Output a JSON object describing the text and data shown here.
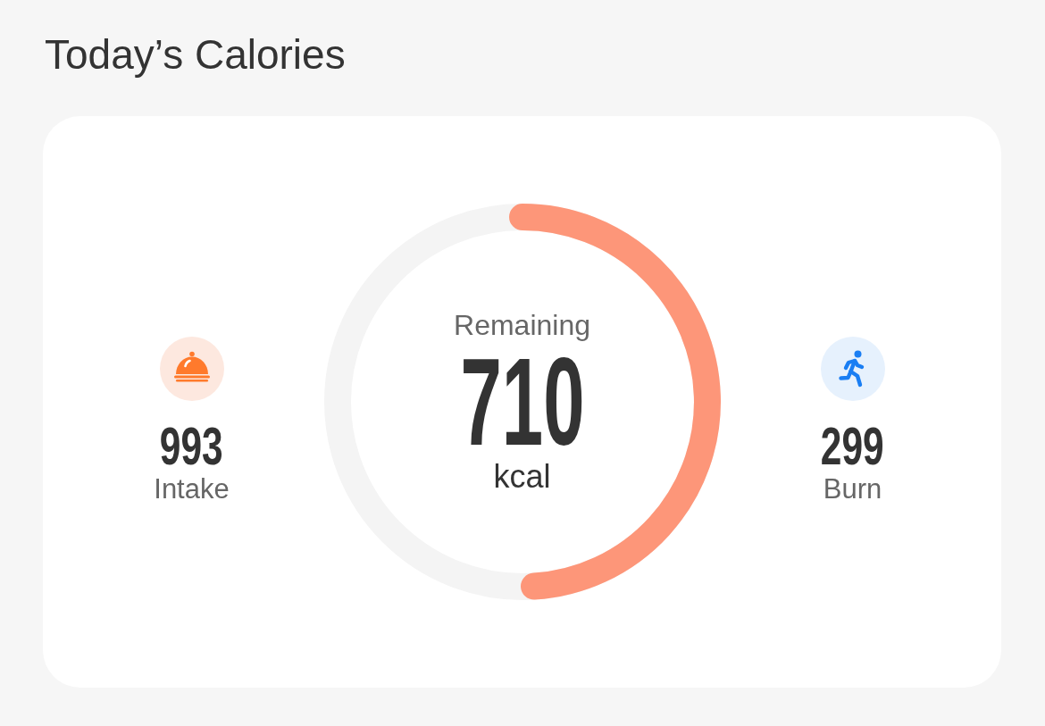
{
  "title": "Today’s Calories",
  "card": {
    "stats": [
      {
        "kind": "intake",
        "value": "993",
        "label": "Intake"
      },
      {
        "kind": "burn",
        "value": "299",
        "label": "Burn"
      }
    ],
    "ring": {
      "label": "Remaining",
      "value": "710",
      "unit": "kcal",
      "level": 0.49
    }
  }
}
